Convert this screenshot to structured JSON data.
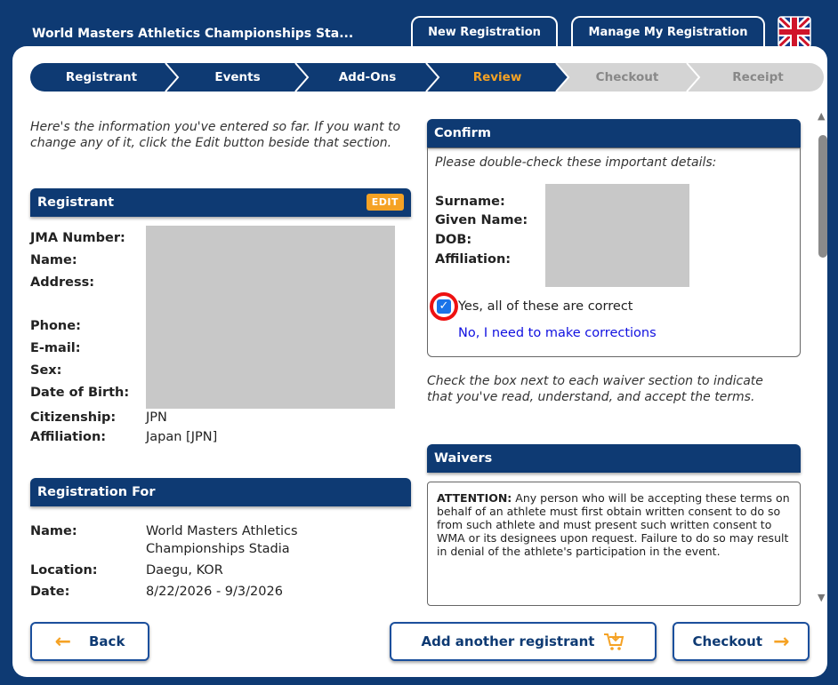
{
  "header": {
    "title": "World Masters Athletics Championships Sta...",
    "tabs": [
      {
        "label": "New Registration"
      },
      {
        "label": "Manage My Registration"
      }
    ],
    "flag_icon": "uk-flag-icon"
  },
  "steps": [
    {
      "label": "Registrant",
      "state": "done"
    },
    {
      "label": "Events",
      "state": "done"
    },
    {
      "label": "Add-Ons",
      "state": "done"
    },
    {
      "label": "Review",
      "state": "current"
    },
    {
      "label": "Checkout",
      "state": "future"
    },
    {
      "label": "Receipt",
      "state": "future"
    }
  ],
  "intro": "Here's the information you've entered so far. If you want to change any of it, click the Edit button beside that section.",
  "registrant": {
    "title": "Registrant",
    "edit_label": "EDIT",
    "labels": {
      "jma": "JMA Number:",
      "name": "Name:",
      "address": "Address:",
      "phone": "Phone:",
      "email": "E-mail:",
      "sex": "Sex:",
      "dob": "Date of Birth:",
      "citizenship": "Citizenship:",
      "affiliation": "Affiliation:"
    },
    "citizenship": "JPN",
    "affiliation": "Japan [JPN]"
  },
  "registration_for": {
    "title": "Registration For",
    "labels": {
      "name": "Name:",
      "location": "Location:",
      "date": "Date:"
    },
    "name_line1": "World Masters Athletics",
    "name_line2": "Championships Stadia",
    "location": "Daegu, KOR",
    "date": "8/22/2026 - 9/3/2026"
  },
  "confirm": {
    "title": "Confirm",
    "prompt": "Please double-check these important details:",
    "labels": {
      "surname": "Surname:",
      "given": "Given Name:",
      "dob": "DOB:",
      "affiliation": "Affiliation:"
    },
    "yes_label": "Yes, all of these are correct",
    "no_label": "No, I need to make corrections"
  },
  "waiver_intro": "Check the box next to each waiver section to indicate that you've read, understand, and accept the terms.",
  "waivers": {
    "title": "Waivers",
    "attention": "ATTENTION:",
    "text": "Any person who will be accepting these terms on behalf of an athlete must first obtain written consent to do so from such athlete and must present such written consent to WMA or its designees upon request. Failure to do so may result in denial of the athlete's participation in the event."
  },
  "buttons": {
    "back": "Back",
    "add_another": "Add another registrant",
    "checkout": "Checkout"
  },
  "colors": {
    "primary": "#0e3a73",
    "accent": "#f5a224",
    "link": "#1010e0"
  }
}
